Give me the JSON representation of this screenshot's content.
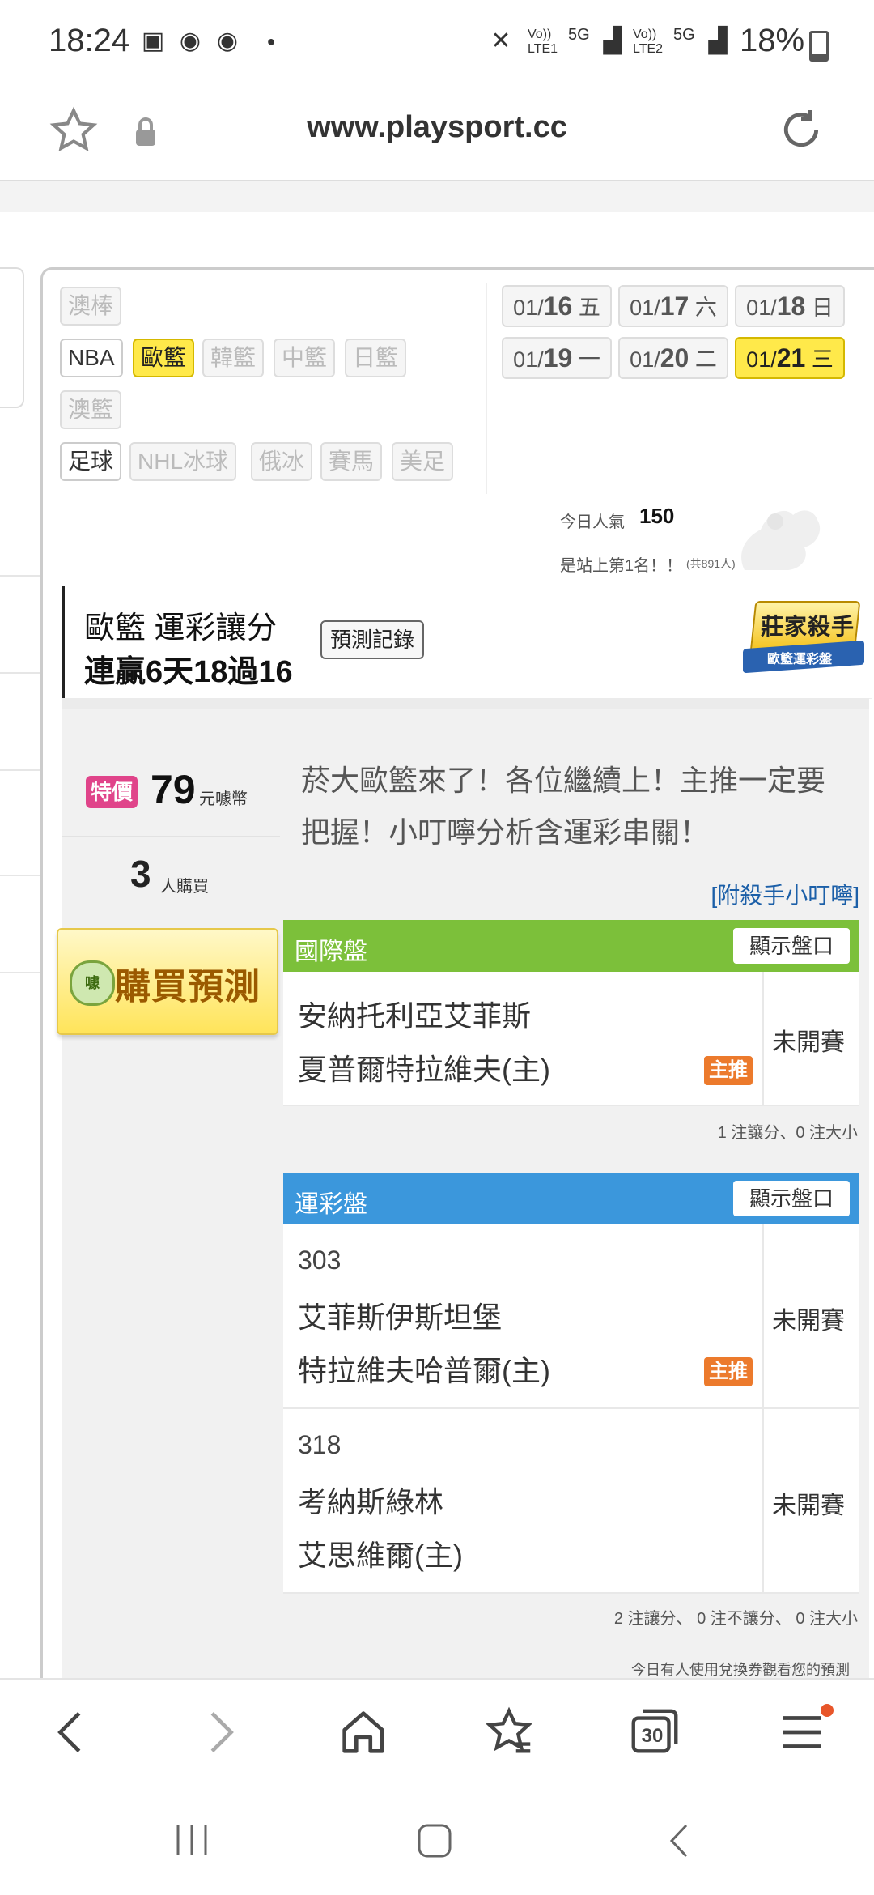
{
  "status_bar": {
    "time": "18:24",
    "net1": "Vo)) LTE1",
    "net2": "Vo)) LTE2",
    "gen1": "5G",
    "gen2": "5G",
    "battery": "18%"
  },
  "browser": {
    "url": "www.playsport.cc",
    "tab_count": "30"
  },
  "sports": {
    "row0": [
      "澳棒"
    ],
    "row1": [
      "NBA",
      "歐籃",
      "韓籃",
      "中籃",
      "日籃"
    ],
    "row2": [
      "澳籃"
    ],
    "row3": [
      "足球",
      "NHL冰球",
      "俄冰",
      "賽馬",
      "美足"
    ],
    "selected": "歐籃"
  },
  "dates": [
    {
      "md": "01/",
      "day": "16",
      "wd": "五"
    },
    {
      "md": "01/",
      "day": "17",
      "wd": "六"
    },
    {
      "md": "01/",
      "day": "18",
      "wd": "日"
    },
    {
      "md": "01/",
      "day": "19",
      "wd": "一"
    },
    {
      "md": "01/",
      "day": "20",
      "wd": "二"
    },
    {
      "md": "01/",
      "day": "21",
      "wd": "三"
    }
  ],
  "popularity": {
    "label": "今日人氣",
    "value": "150",
    "rank_text": "是站上第1名！！",
    "total": "(共891人)"
  },
  "banner": {
    "title": "歐籃 運彩讓分",
    "streak": "連贏6天18過16",
    "record_button": "預測記錄",
    "badge_top": "莊家殺手",
    "badge_bottom": "歐籃運彩盤"
  },
  "offer": {
    "sale_label": "特價",
    "price": "79",
    "price_unit": "元噱幣",
    "buyers": "3",
    "buyers_unit": "人購買",
    "description": "菸大歐籃來了！各位繼續上！主推一定要把握！小叮嚀分析含運彩串關！",
    "killer_link": "[附殺手小叮嚀]",
    "buy_button": "購買預測",
    "buy_coin": "噱"
  },
  "intl_table": {
    "header": "國際盤",
    "show_button": "顯示盤口",
    "rows": [
      {
        "team1": "安納托利亞艾菲斯",
        "team2": "夏普爾特拉維夫(主)",
        "tag": "主推",
        "status": "未開賽"
      }
    ],
    "note": "1 注讓分、0 注大小"
  },
  "lottery_table": {
    "header": "運彩盤",
    "show_button": "顯示盤口",
    "rows": [
      {
        "num": "303",
        "team1": "艾菲斯伊斯坦堡",
        "team2": "特拉維夫哈普爾(主)",
        "tag": "主推",
        "status": "未開賽"
      },
      {
        "num": "318",
        "team1": "考納斯綠林",
        "team2": "艾思維爾(主)",
        "tag": "",
        "status": "未開賽"
      }
    ],
    "note": "2 注讓分、 0 注不讓分、 0 注大小"
  },
  "footer_note": "今日有人使用兌換券觀看您的預測",
  "colors": {
    "intl_header": "#7cc03a",
    "lottery_header": "#3b97dc",
    "selected": "#ffe94a",
    "main_tag": "#ec7a2c",
    "sale_badge": "#e0448a"
  }
}
